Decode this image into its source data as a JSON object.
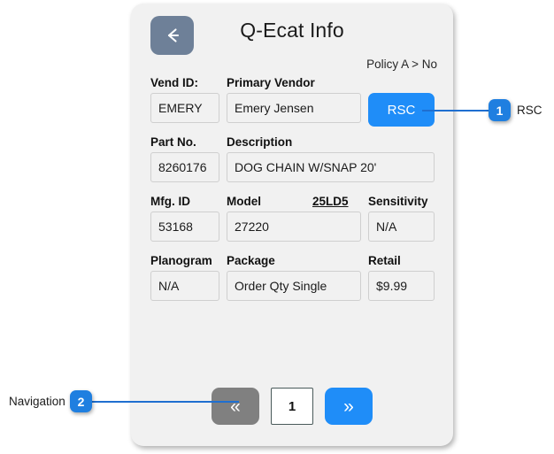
{
  "header": {
    "title": "Q-Ecat Info",
    "back_icon": "arrow-left-icon",
    "breadcrumb": "Policy A > No"
  },
  "form": {
    "rows": [
      {
        "id": "vendor",
        "labels": [
          {
            "text": "Vend ID:",
            "col": "lab-c1"
          },
          {
            "text": "Primary Vendor",
            "col": "lab-c2"
          }
        ],
        "fields": [
          {
            "value": "EMERY",
            "col": "c1",
            "name": "vend-id-field"
          },
          {
            "value": "Emery Jensen",
            "col": "c2",
            "name": "primary-vendor-field"
          }
        ],
        "button": {
          "label": "RSC",
          "name": "rsc-button"
        }
      },
      {
        "id": "part",
        "labels": [
          {
            "text": "Part No.",
            "col": "lab-c1"
          },
          {
            "text": "Description",
            "col": "lab-c2"
          }
        ],
        "fields": [
          {
            "value": "8260176",
            "col": "c1",
            "name": "part-no-field"
          },
          {
            "value": "DOG CHAIN W/SNAP 20'",
            "col": "c2w",
            "name": "description-field"
          }
        ]
      },
      {
        "id": "model",
        "labels": [
          {
            "text": "Mfg. ID",
            "col": "lab-c1"
          },
          {
            "text": "Model",
            "col": "lab-c2"
          },
          {
            "text": "25LD5",
            "col": "lab-model-code",
            "underline": true
          },
          {
            "text": "Sensitivity",
            "col": "lab-c3"
          }
        ],
        "fields": [
          {
            "value": "53168",
            "col": "c1",
            "name": "mfg-id-field"
          },
          {
            "value": "27220",
            "col": "c2",
            "name": "model-field"
          },
          {
            "value": "N/A",
            "col": "c3",
            "name": "sensitivity-field"
          }
        ]
      },
      {
        "id": "package",
        "labels": [
          {
            "text": "Planogram",
            "col": "lab-c1"
          },
          {
            "text": "Package",
            "col": "lab-c2"
          },
          {
            "text": "Retail",
            "col": "lab-c3"
          }
        ],
        "fields": [
          {
            "value": "N/A",
            "col": "c1",
            "name": "planogram-field"
          },
          {
            "value": "Order Qty Single",
            "col": "c2",
            "name": "package-field"
          },
          {
            "value": "$9.99",
            "col": "c3",
            "name": "retail-field"
          }
        ]
      }
    ]
  },
  "pagination": {
    "prev_label": "«",
    "page_number": "1",
    "next_label": "»"
  },
  "callouts": [
    {
      "number": "1",
      "label": "RSC"
    },
    {
      "number": "2",
      "label": "Navigation"
    }
  ],
  "colors": {
    "panel_bg": "#f1f1f1",
    "accent_blue": "#1f8df8",
    "callout_blue": "#1f7fe0",
    "back_slate": "#6e8098",
    "prev_gray": "#808080"
  }
}
